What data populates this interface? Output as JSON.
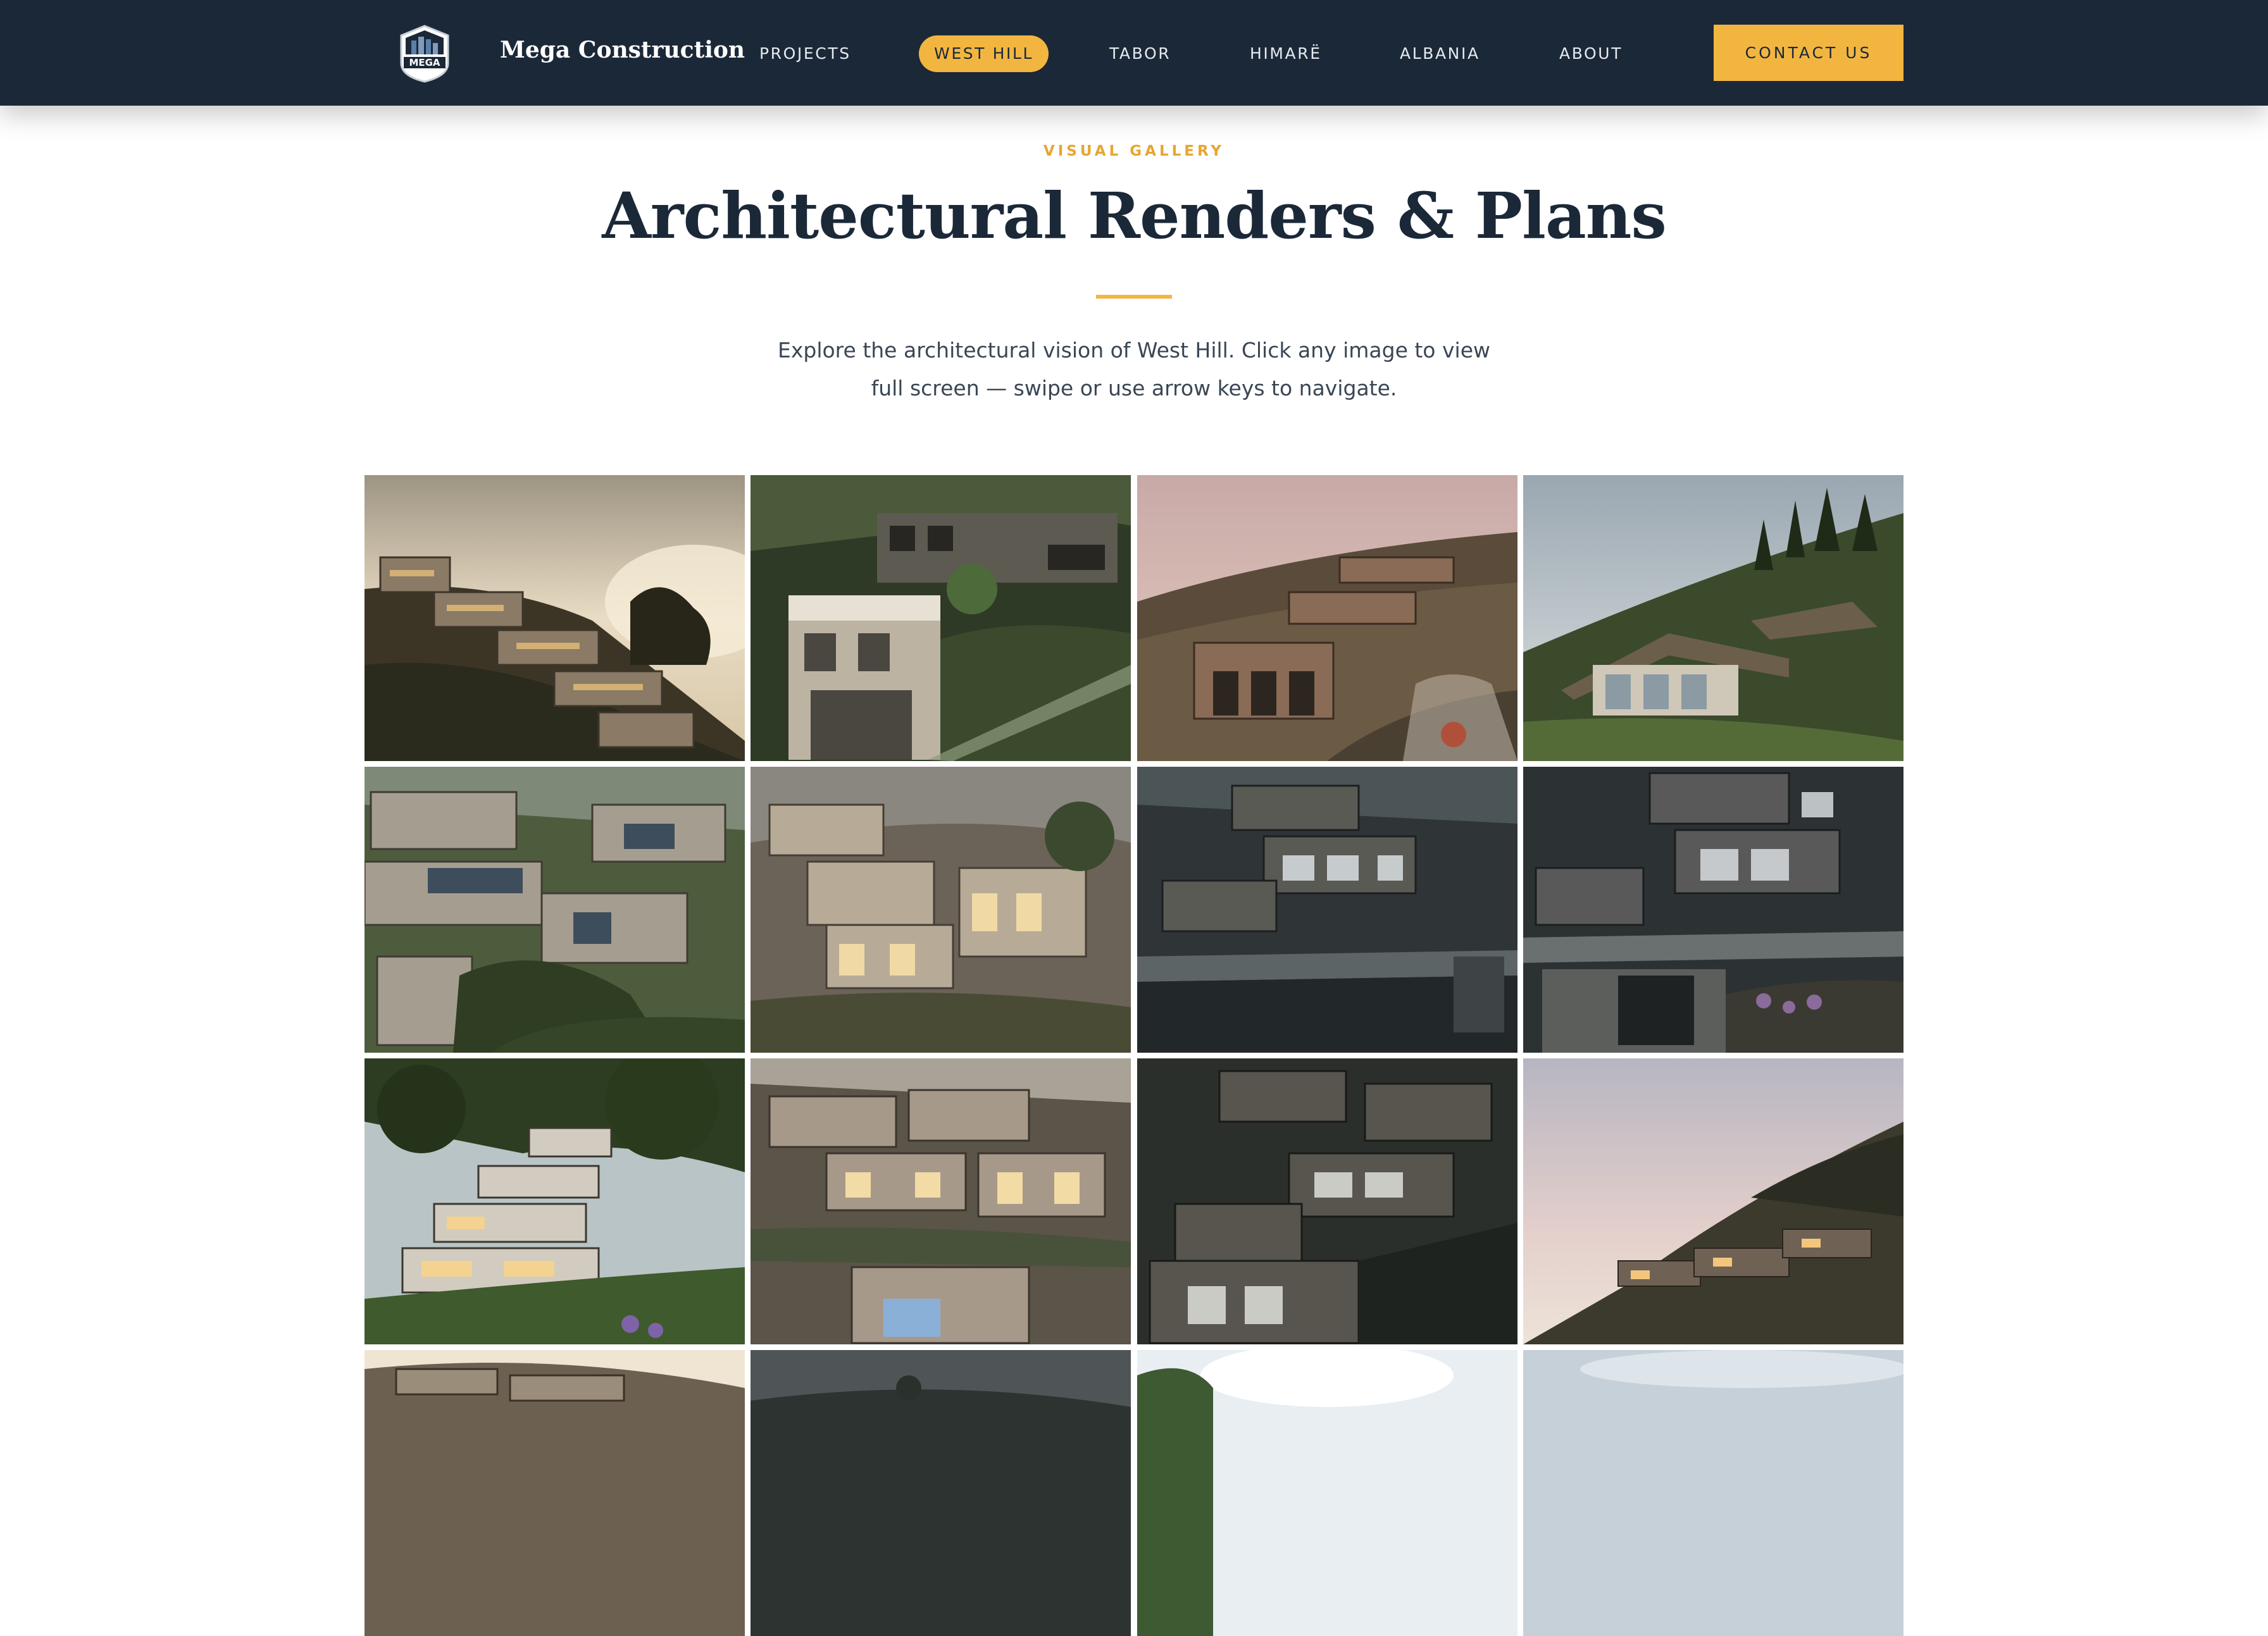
{
  "header": {
    "brand_name": "Mega Construction",
    "logo_text": "MEGA",
    "nav": [
      {
        "label": "PROJECTS",
        "active": false
      },
      {
        "label": "WEST HILL",
        "active": true
      },
      {
        "label": "TABOR",
        "active": false
      },
      {
        "label": "HIMARË",
        "active": false
      },
      {
        "label": "ALBANIA",
        "active": false
      },
      {
        "label": "ABOUT",
        "active": false
      }
    ],
    "contact_label": "CONTACT US"
  },
  "section": {
    "eyebrow": "VISUAL GALLERY",
    "title": "Architectural Renders & Plans",
    "intro": "Explore the architectural vision of West Hill. Click any image to view full screen — swipe or use arrow keys to navigate."
  },
  "colors": {
    "navy": "#1b2838",
    "accent": "#f2b640",
    "eyebrow": "#e7a630"
  },
  "gallery": [
    {
      "name": "render-sunset-terraces"
    },
    {
      "name": "render-stone-tower"
    },
    {
      "name": "render-dusk-pavilion"
    },
    {
      "name": "render-hillside-villa"
    },
    {
      "name": "render-green-terraces"
    },
    {
      "name": "render-cluster-evening"
    },
    {
      "name": "render-night-lower-road"
    },
    {
      "name": "render-night-street"
    },
    {
      "name": "render-forest-terraces"
    },
    {
      "name": "render-stacked-cluster"
    },
    {
      "name": "render-night-cluster"
    },
    {
      "name": "render-pink-sky-slope"
    },
    {
      "name": "render-bottom-1"
    },
    {
      "name": "render-bottom-2"
    },
    {
      "name": "render-bottom-3"
    },
    {
      "name": "render-bottom-4"
    }
  ]
}
